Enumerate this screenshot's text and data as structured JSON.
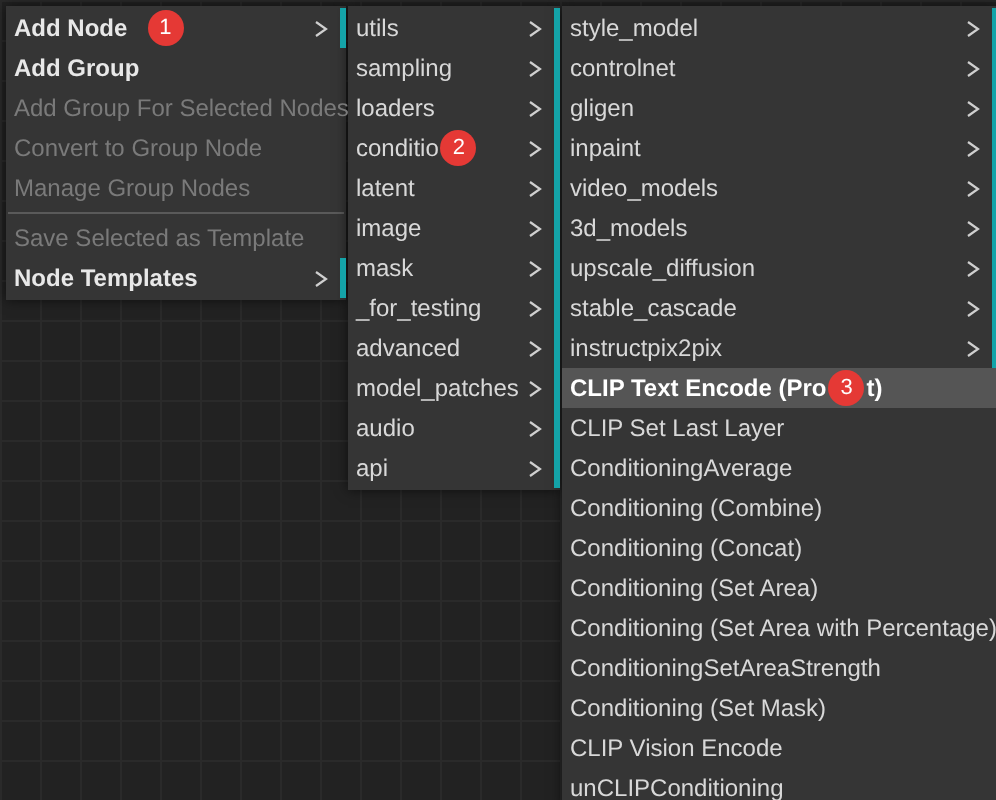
{
  "menus": [
    {
      "items": [
        {
          "label": "Add Node",
          "disabled": false,
          "submenu": true,
          "badge": "1"
        },
        {
          "label": "Add Group",
          "disabled": false,
          "submenu": false
        },
        {
          "label": "Add Group For Selected Nodes",
          "disabled": true,
          "submenu": false
        },
        {
          "label": "Convert to Group Node",
          "disabled": true,
          "submenu": false
        },
        {
          "label": "Manage Group Nodes",
          "disabled": true,
          "submenu": false
        },
        {
          "label": "Save Selected as Template",
          "disabled": true,
          "submenu": false,
          "separator_before": true
        },
        {
          "label": "Node Templates",
          "disabled": false,
          "submenu": true
        }
      ]
    },
    {
      "items": [
        {
          "label": "utils",
          "submenu": true
        },
        {
          "label": "sampling",
          "submenu": true
        },
        {
          "label": "loaders",
          "submenu": true
        },
        {
          "label": "conditio",
          "submenu": true,
          "badge": "2"
        },
        {
          "label": "latent",
          "submenu": true
        },
        {
          "label": "image",
          "submenu": true
        },
        {
          "label": "mask",
          "submenu": true
        },
        {
          "label": "_for_testing",
          "submenu": true
        },
        {
          "label": "advanced",
          "submenu": true
        },
        {
          "label": "model_patches",
          "submenu": true
        },
        {
          "label": "audio",
          "submenu": true
        },
        {
          "label": "api",
          "submenu": true
        }
      ]
    },
    {
      "items": [
        {
          "label": "style_model",
          "submenu": true,
          "selected": false
        },
        {
          "label": "controlnet",
          "submenu": true,
          "selected": false
        },
        {
          "label": "gligen",
          "submenu": true,
          "selected": false
        },
        {
          "label": "inpaint",
          "submenu": true,
          "selected": false
        },
        {
          "label": "video_models",
          "submenu": true,
          "selected": false
        },
        {
          "label": "3d_models",
          "submenu": true,
          "selected": false
        },
        {
          "label": "upscale_diffusion",
          "submenu": true,
          "selected": false
        },
        {
          "label": "stable_cascade",
          "submenu": true,
          "selected": false
        },
        {
          "label": "instructpix2pix",
          "submenu": true,
          "selected": false
        },
        {
          "label": "CLIP Text Encode (Pro",
          "label_after": "t)",
          "submenu": false,
          "selected": true,
          "badge": "3"
        },
        {
          "label": "CLIP Set Last Layer",
          "submenu": false,
          "selected": false
        },
        {
          "label": "ConditioningAverage",
          "submenu": false,
          "selected": false
        },
        {
          "label": "Conditioning (Combine)",
          "submenu": false,
          "selected": false
        },
        {
          "label": "Conditioning (Concat)",
          "submenu": false,
          "selected": false
        },
        {
          "label": "Conditioning (Set Area)",
          "submenu": false,
          "selected": false
        },
        {
          "label": "Conditioning (Set Area with Percentage)",
          "submenu": false,
          "selected": false
        },
        {
          "label": "ConditioningSetAreaStrength",
          "submenu": false,
          "selected": false
        },
        {
          "label": "Conditioning (Set Mask)",
          "submenu": false,
          "selected": false
        },
        {
          "label": "CLIP Vision Encode",
          "submenu": false,
          "selected": false
        },
        {
          "label": "unCLIPConditioning",
          "submenu": false,
          "selected": false
        }
      ]
    }
  ]
}
